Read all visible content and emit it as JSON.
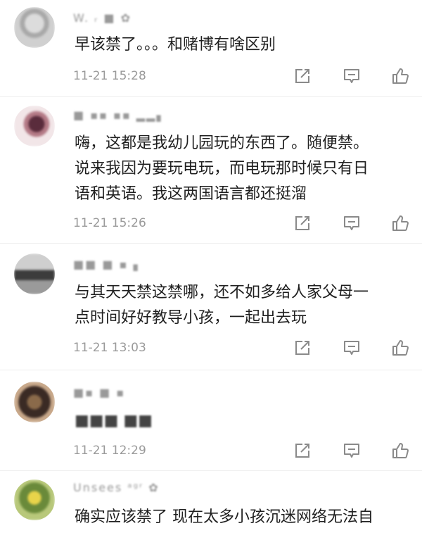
{
  "comments": [
    {
      "name": "W. ᵣ ■ ✿",
      "text": "早该禁了。。。和赌博有啥区别",
      "time": "11-21 15:28"
    },
    {
      "name": "■ ▪▪ ▪▪ ▂▂▖",
      "text": "嗨，这都是我幼儿园玩的东西了。随便禁。\n说来我因为要玩电玩，而电玩那时候只有日\n语和英语。我这两国语言都还挺溜",
      "time": "11-21 15:26"
    },
    {
      "name": "■■ ■ ▪ ▖",
      "text": "与其天天禁这禁哪，还不如多给人家父母一\n点时间好好教导小孩，一起出去玩",
      "time": "11-21 13:03"
    },
    {
      "name": "■▪ ■ ▪",
      "text": "■■■ ■■",
      "time": "11-21 12:29"
    },
    {
      "name": "Unsees ᵃᵍʳ ✿",
      "text": "确实应该禁了 现在太多小孩沉迷网络无法自",
      "time": ""
    }
  ],
  "icons": [
    "share-icon",
    "comment-icon",
    "like-icon"
  ],
  "colors": {
    "icon": "#8a8a8a",
    "meta": "#9a9a9a",
    "divider": "#eeeeee"
  }
}
